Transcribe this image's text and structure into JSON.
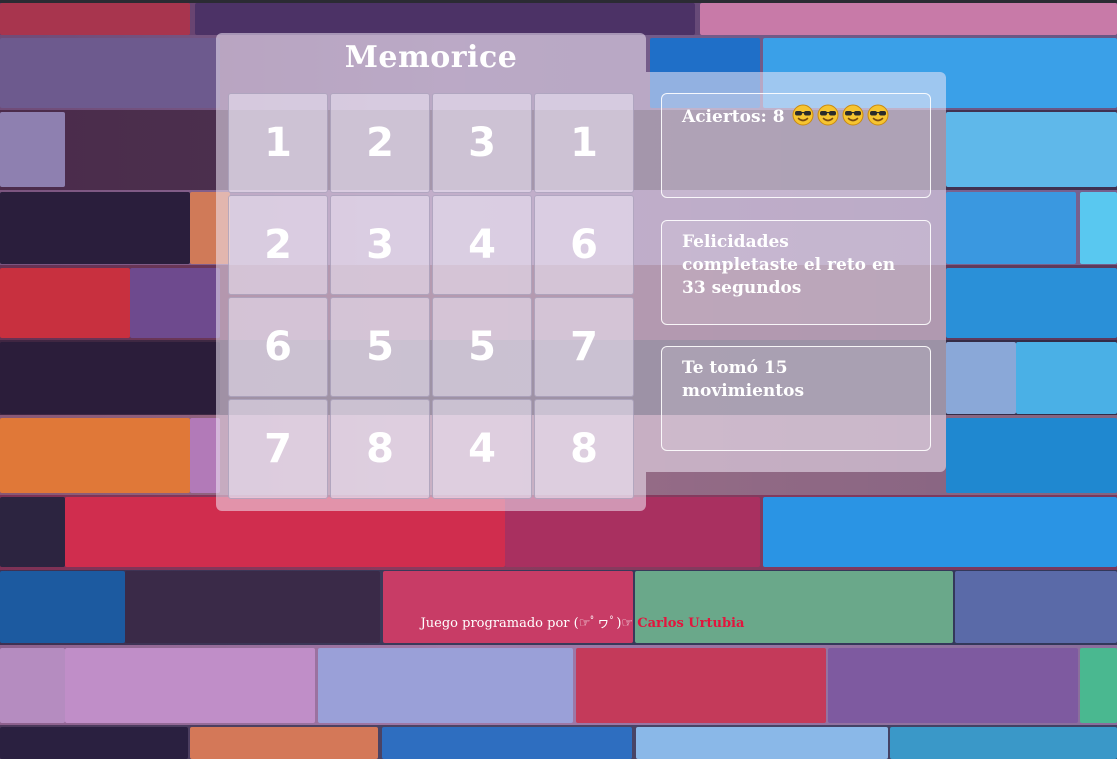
{
  "app": {
    "title": "Memorice"
  },
  "board": {
    "cards": [
      "1",
      "2",
      "3",
      "1",
      "2",
      "3",
      "4",
      "6",
      "6",
      "5",
      "5",
      "7",
      "7",
      "8",
      "4",
      "8"
    ]
  },
  "stats": {
    "hits_label": "Aciertos: 8",
    "hits_emoji_count": 4,
    "emoji_icon": "smiling-face-with-sunglasses",
    "congrats_text": "Felicidades completaste el reto en 33 segundos",
    "moves_text": "Te tomó 15 movimientos"
  },
  "footer": {
    "text": "Juego programado por (☞ﾟヮﾟ)☞",
    "author_link": "Carlos Urtubia",
    "author_color": "#e2153d"
  }
}
